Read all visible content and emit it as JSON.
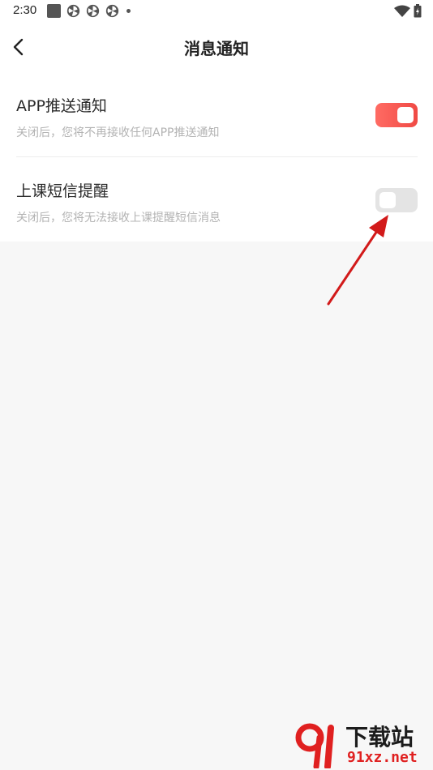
{
  "status_bar": {
    "time": "2:30"
  },
  "header": {
    "title": "消息通知"
  },
  "settings": [
    {
      "title": "APP推送通知",
      "description": "关闭后，您将不再接收任何APP推送通知",
      "enabled": true
    },
    {
      "title": "上课短信提醒",
      "description": "关闭后，您将无法接收上课提醒短信消息",
      "enabled": false
    }
  ],
  "watermark": {
    "title": "下载站",
    "domain": "91xz.net"
  },
  "colors": {
    "accent": "#f25650",
    "toggle_off": "#e4e4e4",
    "annotation_arrow": "#d21a1a"
  }
}
